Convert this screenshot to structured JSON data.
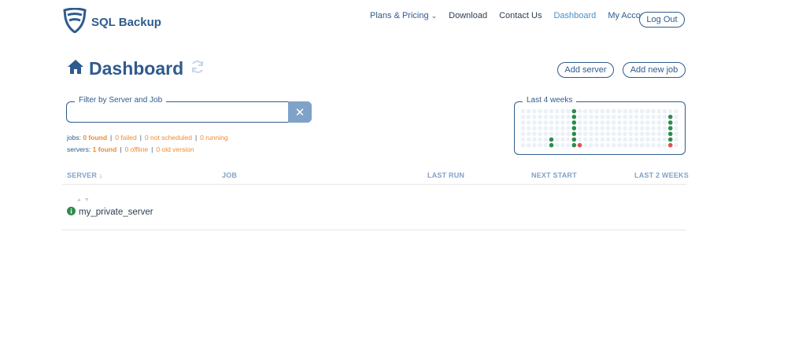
{
  "brand": {
    "name": "SQL Backup"
  },
  "nav": {
    "items": [
      "Plans & Pricing",
      "Download",
      "Contact Us",
      "Dashboard",
      "My Account"
    ],
    "logout": "Log Out"
  },
  "page": {
    "title": "Dashboard",
    "refresh_icon": "refresh-icon",
    "home_icon": "home-icon"
  },
  "actions": {
    "add_server": "Add server",
    "add_job": "Add new job"
  },
  "filter": {
    "legend": "Filter by Server and Job",
    "value": "",
    "clear_icon": "close-icon"
  },
  "stats": {
    "jobs_label": "jobs:",
    "jobs_found": "0 found",
    "jobs_failed": "0 failed",
    "jobs_not_scheduled": "0 not scheduled",
    "jobs_running": "0 running",
    "servers_label": "servers:",
    "servers_found": "1 found",
    "servers_offline": "0 offline",
    "servers_old_version": "0 old version"
  },
  "weeks": {
    "legend": "Last 4 weeks",
    "cols": 28,
    "rows": 7,
    "green_dots": [
      [
        5,
        5
      ],
      [
        5,
        6
      ],
      [
        9,
        0
      ],
      [
        9,
        1
      ],
      [
        9,
        2
      ],
      [
        9,
        3
      ],
      [
        9,
        4
      ],
      [
        9,
        5
      ],
      [
        9,
        6
      ],
      [
        26,
        1
      ],
      [
        26,
        2
      ],
      [
        26,
        3
      ],
      [
        26,
        4
      ],
      [
        26,
        5
      ]
    ],
    "red_dots": [
      [
        10,
        6
      ],
      [
        26,
        6
      ]
    ],
    "colors": {
      "empty": "#eaf1f8",
      "success": "#2e8b4f",
      "failed": "#e05050"
    }
  },
  "table": {
    "headers": {
      "server": "SERVER",
      "sort_icon": "arrow-down-icon",
      "job": "JOB",
      "last_run": "LAST RUN",
      "next_start": "NEXT START",
      "last_2_weeks": "LAST 2 WEEKS"
    },
    "rows": [
      {
        "server": "my_private_server",
        "status_icon": "info-icon"
      }
    ]
  },
  "colors": {
    "primary": "#2f5b8e",
    "accent": "#4a90c8",
    "orange": "#f08a30",
    "header_gray": "#7fa2c8"
  }
}
